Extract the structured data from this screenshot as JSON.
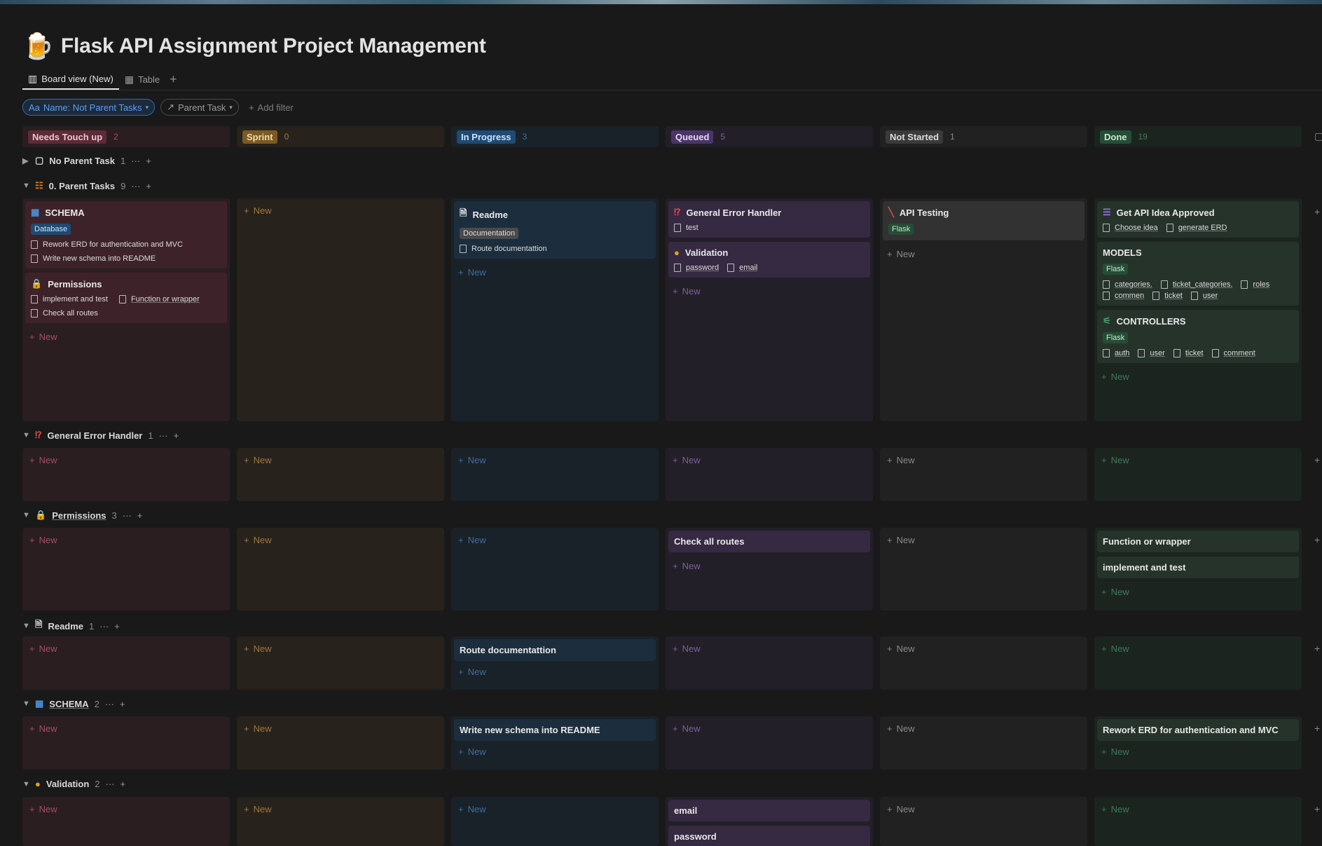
{
  "page": {
    "icon": "beer-mug-icon",
    "title": "Flask API Assignment Project Management"
  },
  "tabs": [
    {
      "label": "Board view (New)",
      "icon": "board-icon"
    },
    {
      "label": "Table",
      "icon": "table-icon"
    }
  ],
  "filters": {
    "name_filter": "Name: Not Parent Tasks",
    "name_prefix": "Aa",
    "parent_filter": "Parent Task",
    "add_filter": "Add filter"
  },
  "columns": [
    {
      "label": "Needs Touch up",
      "count": "2",
      "color": "#5c2b37"
    },
    {
      "label": "Sprint",
      "count": "0",
      "color": "#7a5a22"
    },
    {
      "label": "In Progress",
      "count": "3",
      "color": "#1f4a73"
    },
    {
      "label": "Queued",
      "count": "5",
      "color": "#4b3567"
    },
    {
      "label": "Not Started",
      "count": "1",
      "color": "#3a3a3a"
    },
    {
      "label": "Done",
      "count": "19",
      "color": "#264d36"
    }
  ],
  "new_label": "New",
  "groups": {
    "no_parent": {
      "label": "No Parent Task",
      "count": "1"
    },
    "parent_tasks": {
      "label": "0. Parent Tasks",
      "count": "9"
    },
    "general_error": {
      "label": "General Error Handler",
      "count": "1"
    },
    "permissions": {
      "label": "Permissions",
      "count": "3"
    },
    "readme": {
      "label": "Readme",
      "count": "1"
    },
    "schema": {
      "label": "SCHEMA",
      "count": "2"
    },
    "validation": {
      "label": "Validation",
      "count": "2"
    }
  },
  "cards": {
    "schema": {
      "title": "SCHEMA",
      "tag": "Database",
      "subs": [
        "Rework ERD for authentication and MVC",
        "Write new schema into README"
      ]
    },
    "permissions": {
      "title": "Permissions",
      "subs": [
        "implement and test",
        "Function or wrapper",
        "Check all routes"
      ]
    },
    "readme": {
      "title": "Readme",
      "tag": "Documentation",
      "subs": [
        "Route documentattion"
      ]
    },
    "general_error": {
      "title": "General Error Handler",
      "subs": [
        "test"
      ]
    },
    "validation": {
      "title": "Validation",
      "subs": [
        "password",
        "email"
      ]
    },
    "api_testing": {
      "title": "API Testing",
      "tag": "Flask"
    },
    "get_api": {
      "title": "Get API Idea Approved",
      "subs": [
        "Choose idea",
        "generate ERD"
      ]
    },
    "models": {
      "title": "MODELS",
      "tag": "Flask",
      "subs": [
        "categories.",
        "ticket_categories.",
        "roles",
        "commen",
        "ticket",
        "user"
      ]
    },
    "controllers": {
      "title": "CONTROLLERS",
      "tag": "Flask",
      "subs": [
        "auth",
        "user",
        "ticket",
        "comment"
      ]
    },
    "check_all_routes": "Check all routes",
    "function_or_wrapper": "Function or wrapper",
    "implement_and_test": "implement and test",
    "route_doc": "Route documentattion",
    "write_schema": "Write new schema into README",
    "rework_erd": "Rework ERD for authentication and MVC",
    "email": "email",
    "password": "password"
  }
}
